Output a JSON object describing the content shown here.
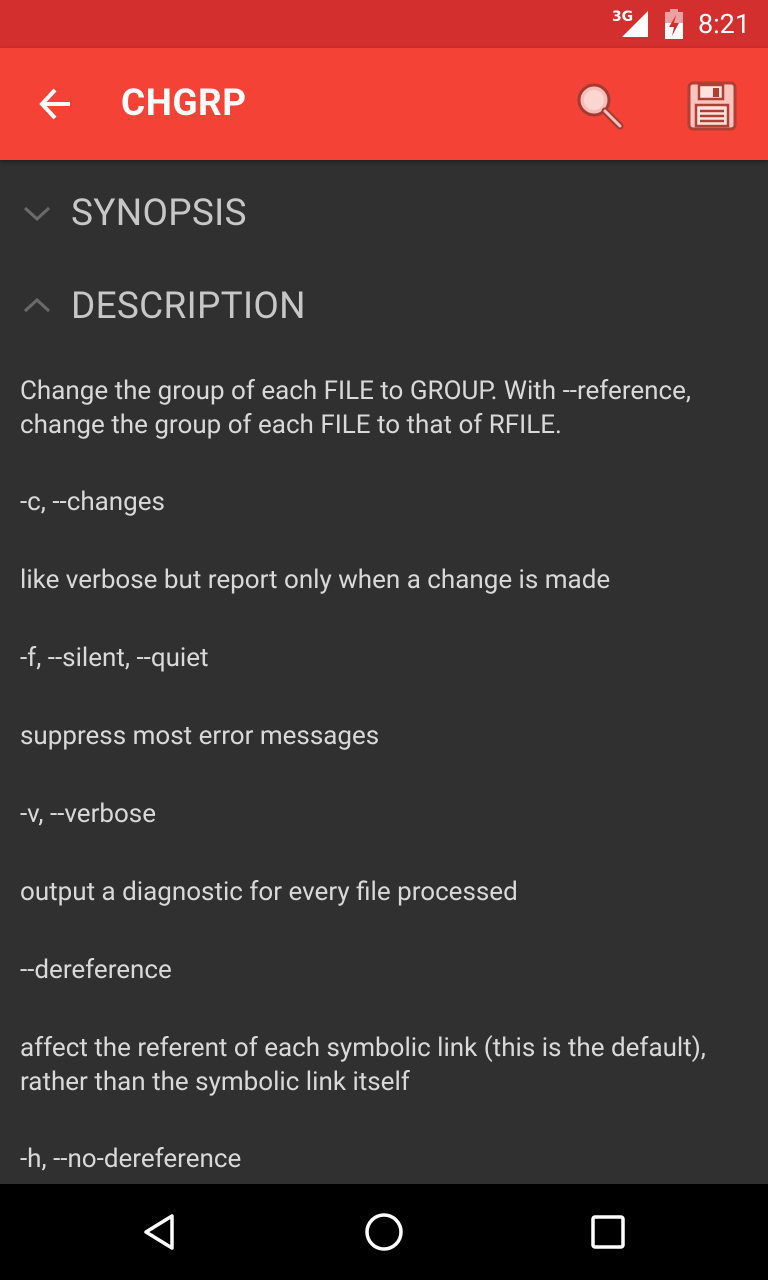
{
  "status_bar": {
    "network_label": "3G",
    "time": "8:21"
  },
  "app_bar": {
    "title": "CHGRP",
    "back_icon": "arrow-back-icon",
    "search_icon": "magnifier-icon",
    "save_icon": "floppy-disk-icon"
  },
  "sections": {
    "synopsis": {
      "label": "SYNOPSIS",
      "expanded": false
    },
    "description": {
      "label": "DESCRIPTION",
      "expanded": true
    }
  },
  "description": {
    "intro": "Change the group of each FILE to GROUP. With --reference, change the group of each FILE to that of RFILE.",
    "p1": "-c, --changes",
    "p2": "like verbose but report only when a change is made",
    "p3": "-f, --silent, --quiet",
    "p4": "suppress most error messages",
    "p5": "-v, --verbose",
    "p6": "output a diagnostic for every file processed",
    "p7": "--dereference",
    "p8": "affect the referent of each symbolic link (this is the default), rather than the symbolic link itself",
    "p9": "-h, --no-dereference"
  },
  "nav_bar": {
    "back": "triangle-back-icon",
    "home": "circle-home-icon",
    "recents": "square-recents-icon"
  },
  "colors": {
    "status_bar": "#d32f2f",
    "app_bar": "#f44336",
    "background": "#303030",
    "text": "#d9d9d9",
    "header_text": "#c7c7c7"
  }
}
